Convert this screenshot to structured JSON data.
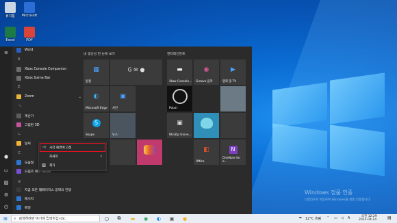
{
  "desktop": {
    "icons": [
      {
        "label": "휴지통",
        "color": "#c9d6e4"
      },
      {
        "label": "Microsoft",
        "color": "#2b6fd6"
      },
      {
        "label": "Excel",
        "color": "#1d7a45"
      },
      {
        "label": "PDF",
        "color": "#d9443a"
      }
    ],
    "watermark": {
      "title": "Windows 정품 인증",
      "subtitle": "[설정]으로 이동하여 Windows를 정품 인증합니다."
    }
  },
  "start_menu": {
    "apps": [
      {
        "label": "Word",
        "icon": "word-icon",
        "color": "#2b5fbf"
      },
      {
        "letter": "X"
      },
      {
        "label": "Xbox Console Companion",
        "icon": "xbox-icon",
        "color": "#6d6d6d"
      },
      {
        "label": "Xbox Game Bar",
        "icon": "xbox-icon",
        "color": "#6d6d6d"
      },
      {
        "letter": "Z"
      },
      {
        "label": "Zoom",
        "icon": "folder-icon",
        "color": "#e8b43a",
        "expand": "⌄"
      },
      {
        "letter": "ㄱ"
      },
      {
        "label": "계산기",
        "icon": "calculator-icon",
        "color": "#5d5d5d"
      },
      {
        "label": "그림판 3D",
        "icon": "paint-icon",
        "color": "#c5529c"
      },
      {
        "letter": "ㄴ"
      },
      {
        "label": "날씨",
        "icon": "weather-icon",
        "color": "#f2b233"
      },
      {
        "letter": "ㄷ"
      },
      {
        "label": "도움말",
        "icon": "help-icon",
        "color": "#2b77d6"
      },
      {
        "label": "드림즈 애니 메이트",
        "icon": "app-icon",
        "color": "#7a4fd6"
      },
      {
        "letter": "ㄹ"
      },
      {
        "label": "지금 모든 웹페이지스 공략의 전쟁",
        "icon": "app-icon",
        "color": "#3a3a3a"
      },
      {
        "label": "메시지",
        "icon": "message-icon",
        "color": "#2b77d6"
      },
      {
        "label": "메일",
        "icon": "mail-icon",
        "color": "#2b77d6"
      }
    ],
    "groups": [
      {
        "title": "네 생산성 한 눈에 보기"
      },
      {
        "title": "엔터테인먼트"
      }
    ],
    "tiles": [
      {
        "label": "일정",
        "icon": "▦",
        "bg": "#3b3b3b"
      },
      {
        "label": "",
        "icon": "G ✉ ●",
        "bg": "#3b3b3b"
      },
      {
        "label": "Microsoft Edge",
        "icon": "◐",
        "bg": "#3b3b3b"
      },
      {
        "label": "사진",
        "icon": "▣",
        "bg": "#3b3b3b"
      },
      {
        "label": "Skype",
        "icon": "S",
        "bg": "#3b3b3b"
      },
      {
        "label": "뉴스",
        "icon": "",
        "bg": "#4b5560"
      },
      {
        "label": "",
        "icon": "",
        "bg": "#3b3b3b"
      },
      {
        "label": "",
        "icon": "",
        "bg": "#c13a6e"
      },
      {
        "label": "Xbox Console...",
        "icon": "▬",
        "bg": "#3b3b3b"
      },
      {
        "label": "Groove 음악",
        "icon": "◉",
        "bg": "#3b3b3b"
      },
      {
        "label": "영화 및 TV",
        "icon": "▶",
        "bg": "#3b3b3b"
      },
      {
        "label": "Polarr",
        "icon": "○",
        "bg": "#111111"
      },
      {
        "label": "",
        "icon": "",
        "bg": "#6b7a85"
      },
      {
        "label": "WinZip Unive...",
        "icon": "▣",
        "bg": "#3b3b3b"
      },
      {
        "label": "",
        "icon": "",
        "bg": "#2f8fb8"
      },
      {
        "label": "",
        "icon": "",
        "bg": "#3b3b3b"
      },
      {
        "label": "Office",
        "icon": "◧",
        "bg": "#3b3b3b"
      },
      {
        "label": "OneNote for o...",
        "icon": "N",
        "bg": "#3b3b3b"
      }
    ]
  },
  "context_menu": {
    "items": [
      {
        "label": "시작 화면에 고정",
        "icon": "⊣"
      },
      {
        "label": "자세히",
        "icon": "",
        "arrow": "›"
      },
      {
        "label": "제거",
        "icon": "▥"
      }
    ]
  },
  "taskbar": {
    "search_placeholder": "검색하려면 여기에 입력하십시오.",
    "weather": "12°C 흐림",
    "time": "오전 12:29",
    "date": "2022-04-14"
  }
}
